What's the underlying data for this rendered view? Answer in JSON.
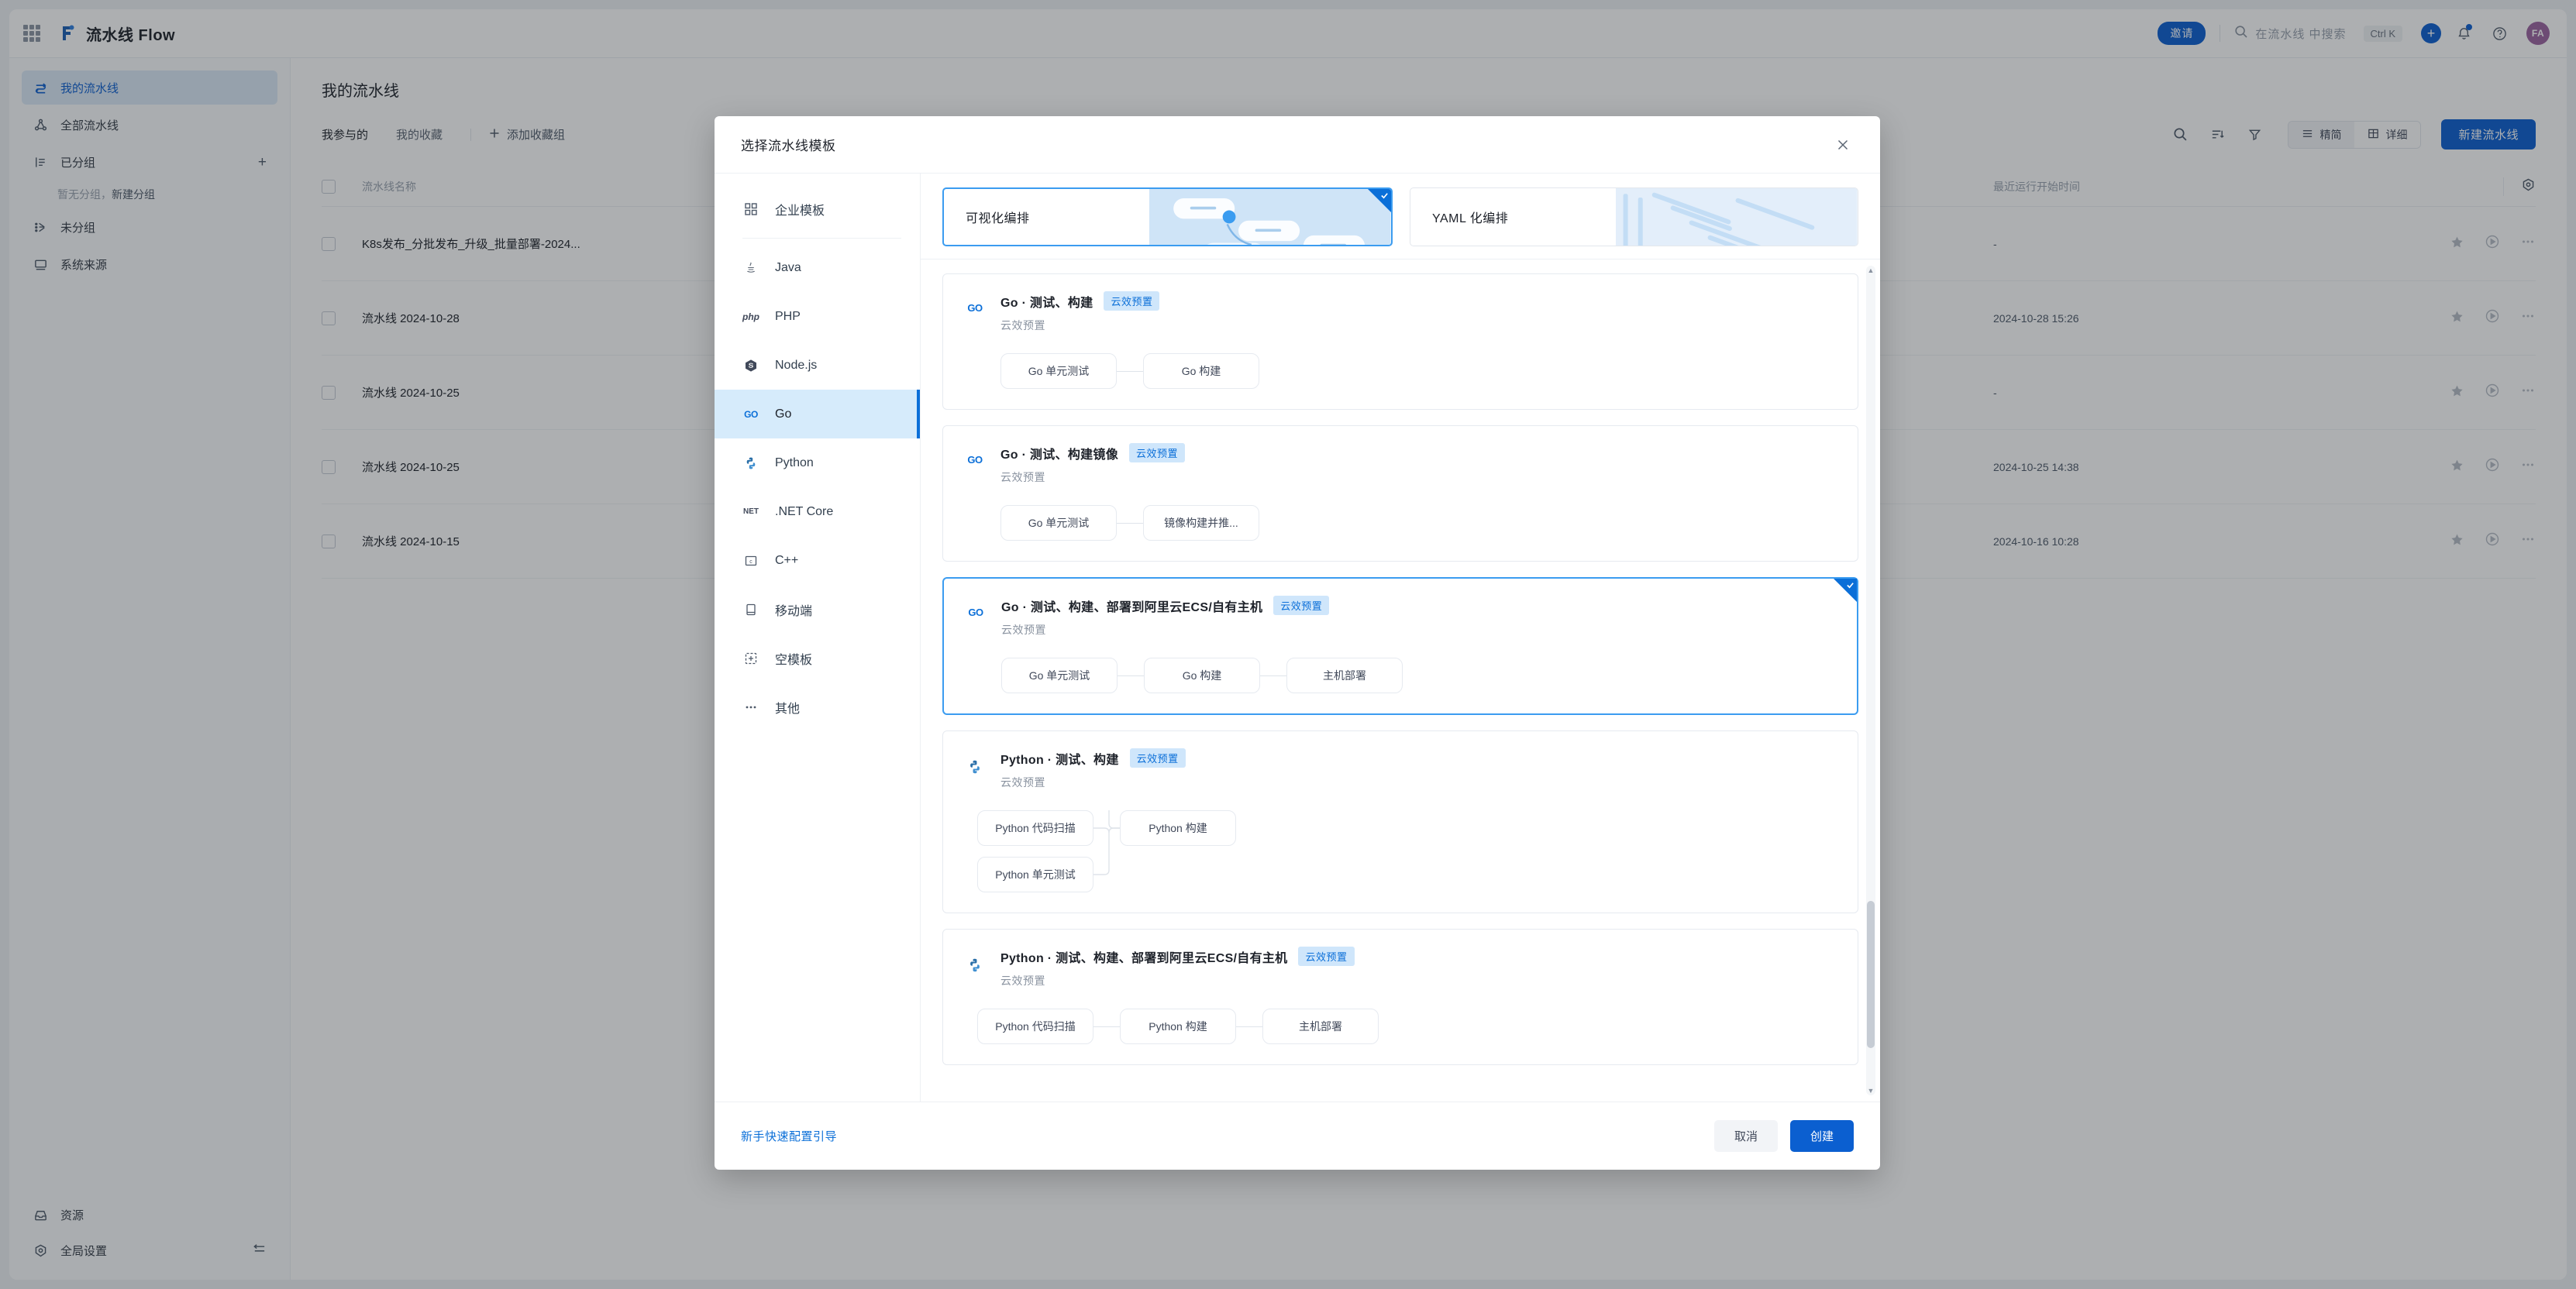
{
  "topbar": {
    "app_grid_icon": "grid-icon",
    "brand_title": "流水线 Flow",
    "invite_label": "邀请",
    "search_placeholder": "在流水线 中搜索",
    "search_icon": "search-icon",
    "shortcut": "Ctrl K",
    "plus_icon": "plus-icon",
    "bell_icon": "bell-icon",
    "help_icon": "question-circle-icon",
    "avatar_initials": "FA"
  },
  "sidebar": {
    "items": [
      {
        "label": "我的流水线",
        "icon": "pipeline-icon",
        "active": true
      },
      {
        "label": "全部流水线",
        "icon": "nodes-icon",
        "active": false
      },
      {
        "label": "已分组",
        "icon": "group-list-icon",
        "active": false,
        "has_plus": true
      }
    ],
    "empty_group_text": "暂无分组，",
    "empty_group_link": "新建分组",
    "items2": [
      {
        "label": "未分组",
        "icon": "ungrouped-icon"
      },
      {
        "label": "系统来源",
        "icon": "monitor-icon"
      }
    ],
    "bottom": [
      {
        "label": "资源",
        "icon": "inbox-icon"
      },
      {
        "label": "全局设置",
        "icon": "settings-hex-icon",
        "has_collapse": true
      }
    ]
  },
  "main": {
    "page_title": "我的流水线",
    "tabs": [
      {
        "label": "我参与的",
        "active": true
      },
      {
        "label": "我的收藏",
        "active": false
      }
    ],
    "add_fav_group": "添加收藏组",
    "toolbar_icons": [
      "search-icon",
      "sort-icon",
      "filter-icon"
    ],
    "view_modes": [
      {
        "label": "精简",
        "icon": "list-icon",
        "active": true
      },
      {
        "label": "详细",
        "icon": "table-icon",
        "active": false
      }
    ],
    "new_pipeline_label": "新建流水线",
    "table": {
      "columns": [
        "流水线名称",
        "最近运行开始时间"
      ],
      "settings_icon": "gear-hex-icon",
      "rows": [
        {
          "name": "K8s发布_分批发布_升级_批量部署-2024...",
          "time": "-"
        },
        {
          "name": "流水线 2024-10-28",
          "time": "2024-10-28 15:26"
        },
        {
          "name": "流水线 2024-10-25",
          "time": "-"
        },
        {
          "name": "流水线 2024-10-25",
          "time": "2024-10-25 14:38"
        },
        {
          "name": "流水线 2024-10-15",
          "time": "2024-10-16 10:28"
        }
      ],
      "row_actions": [
        "star-icon",
        "play-icon",
        "more-icon"
      ]
    }
  },
  "modal": {
    "title": "选择流水线模板",
    "close_icon": "close-icon",
    "categories": [
      {
        "label": "企业模板",
        "icon": "blocks-icon",
        "active": false,
        "sep_after": true
      },
      {
        "label": "Java",
        "icon": "java-icon",
        "active": false
      },
      {
        "label": "PHP",
        "icon": "php-icon",
        "active": false
      },
      {
        "label": "Node.js",
        "icon": "nodejs-icon",
        "active": false
      },
      {
        "label": "Go",
        "icon": "go-icon",
        "active": true
      },
      {
        "label": "Python",
        "icon": "python-icon",
        "active": false
      },
      {
        "label": ".NET Core",
        "icon": "dotnet-icon",
        "active": false
      },
      {
        "label": "C++",
        "icon": "cpp-icon",
        "active": false
      },
      {
        "label": "移动端",
        "icon": "mobile-icon",
        "active": false
      },
      {
        "label": "空模板",
        "icon": "empty-template-icon",
        "active": false
      },
      {
        "label": "其他",
        "icon": "ellipsis-icon",
        "active": false
      }
    ],
    "modes": [
      {
        "label": "可视化编排",
        "selected": true
      },
      {
        "label": "YAML 化编排",
        "selected": false
      }
    ],
    "templates": [
      {
        "name": "Go · 测试、构建",
        "badge": "云效预置",
        "subtitle": "云效预置",
        "icon": "go-icon",
        "selected": false,
        "layout": "linear",
        "stages": [
          "Go 单元测试",
          "Go 构建"
        ]
      },
      {
        "name": "Go · 测试、构建镜像",
        "badge": "云效预置",
        "subtitle": "云效预置",
        "icon": "go-icon",
        "selected": false,
        "layout": "linear",
        "stages": [
          "Go 单元测试",
          "镜像构建并推..."
        ]
      },
      {
        "name": "Go · 测试、构建、部署到阿里云ECS/自有主机",
        "badge": "云效预置",
        "subtitle": "云效预置",
        "icon": "go-icon",
        "selected": true,
        "layout": "linear",
        "stages": [
          "Go 单元测试",
          "Go 构建",
          "主机部署"
        ]
      },
      {
        "name": "Python · 测试、构建",
        "badge": "云效预置",
        "subtitle": "云效预置",
        "icon": "python-icon",
        "selected": false,
        "layout": "branch",
        "branch_stages": [
          "Python 代码扫描",
          "Python 单元测试"
        ],
        "stages": [
          "Python 构建"
        ]
      },
      {
        "name": "Python · 测试、构建、部署到阿里云ECS/自有主机",
        "badge": "云效预置",
        "subtitle": "云效预置",
        "icon": "python-icon",
        "selected": false,
        "layout": "linear",
        "stages": [
          "Python 代码扫描",
          "Python 构建",
          "主机部署"
        ]
      }
    ],
    "footer": {
      "guide_link": "新手快速配置引导",
      "cancel_label": "取消",
      "create_label": "创建"
    }
  },
  "colors": {
    "accent": "#0b5fd0",
    "accent_light": "#3b9cf0",
    "badge_bg": "#cfe6fb",
    "sidebar_active_bg": "#dbe9f7",
    "avatar_bg": "#9b63a0"
  }
}
